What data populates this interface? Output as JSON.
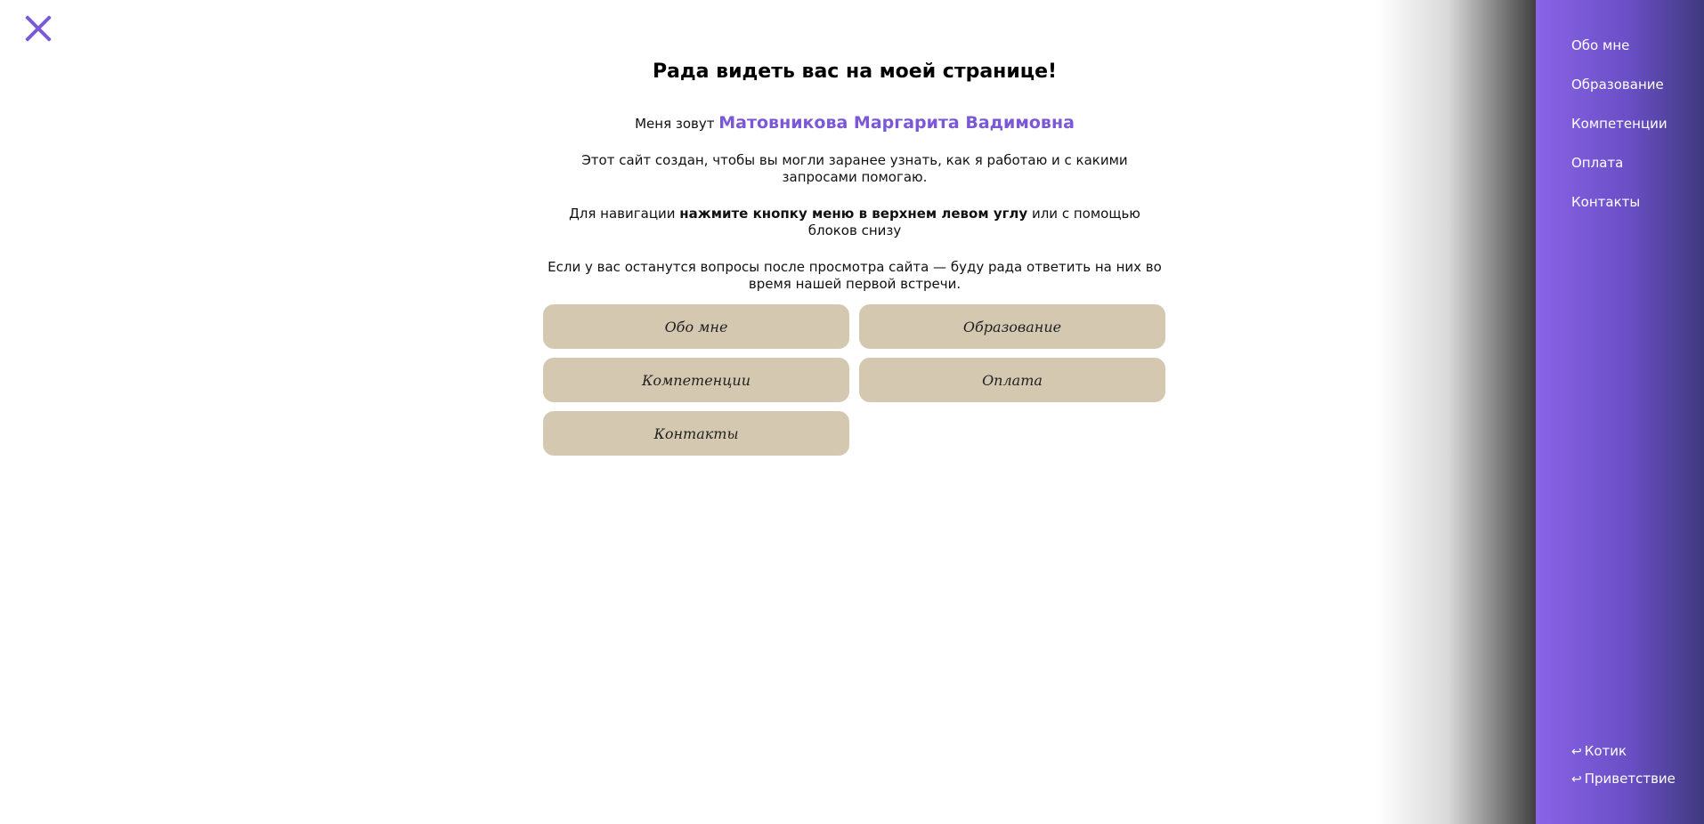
{
  "close": {
    "icon": "close-icon"
  },
  "main": {
    "greeting": "Рада видеть вас на моей странице!",
    "intro_prefix": "Меня зовут ",
    "intro_name": "Матовникова Маргарита Вадимовна",
    "paragraph1": "Этот сайт создан, чтобы вы могли заранее узнать, как я работаю и с какими запросами помогаю.",
    "paragraph2_before": "Для навигации ",
    "paragraph2_bold": "нажмите кнопку меню в верхнем левом углу",
    "paragraph2_after": " или с помощью блоков снизу",
    "paragraph3": "Если у вас останутся вопросы после просмотра сайта — буду рада ответить на них во время нашей первой встречи."
  },
  "blocks": [
    {
      "label": "Обо мне"
    },
    {
      "label": "Образование"
    },
    {
      "label": "Компетенции"
    },
    {
      "label": "Оплата"
    },
    {
      "label": "Контакты"
    }
  ],
  "sidebar": {
    "items": [
      {
        "label": "Обо мне"
      },
      {
        "label": "Образование"
      },
      {
        "label": "Компетенции"
      },
      {
        "label": "Оплата"
      },
      {
        "label": "Контакты"
      }
    ],
    "back_links": [
      {
        "icon": "return-arrow-icon",
        "arrow": "↩",
        "label": "Котик"
      },
      {
        "icon": "return-arrow-icon",
        "arrow": "↩",
        "label": "Приветствие"
      }
    ]
  },
  "colors": {
    "accent": "#7a58d6",
    "block_bg": "#d5c8b0",
    "sidebar_start": "#8a64e6",
    "sidebar_end": "#3f3a7e"
  }
}
